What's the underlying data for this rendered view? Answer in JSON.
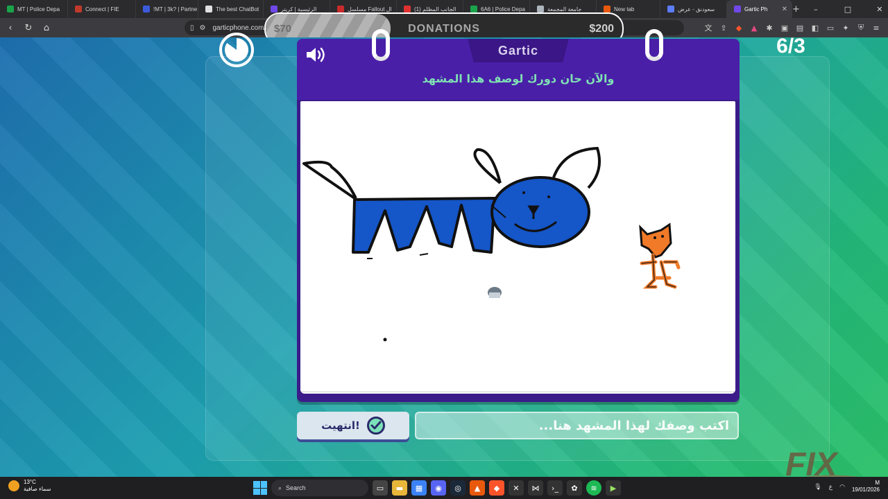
{
  "browser": {
    "tabs": [
      {
        "label": "MT | Police Depa",
        "color": "#1aa34a"
      },
      {
        "label": "Connect | FIE",
        "color": "#c0392b"
      },
      {
        "label": "!MT | 3k? | Partne",
        "color": "#3b5bdb"
      },
      {
        "label": "The best ChatBot",
        "color": "#e0e0e0"
      },
      {
        "label": "الرئيسية | كريتر",
        "color": "#7048e8"
      },
      {
        "label": "مسلسل Fallout ال",
        "color": "#c92a2a"
      },
      {
        "label": "(1) الجانب المظلم",
        "color": "#e03131"
      },
      {
        "label": "6A6 | Police Depa",
        "color": "#1aa34a"
      },
      {
        "label": "جامعة المجمعة",
        "color": "#adb5bd"
      },
      {
        "label": "New tab",
        "color": "#e8590c"
      },
      {
        "label": "سعودنق - عرض",
        "color": "#5c7cfa"
      },
      {
        "label": "Gartic Ph",
        "color": "#7048e8"
      }
    ],
    "url": "garticphone.com/ar/"
  },
  "donations": {
    "current": "$70",
    "label": "DONATIONS",
    "goal": "$200",
    "progress": 0.35
  },
  "game": {
    "logo": "Gartic",
    "round": "6/3",
    "prompt": "والآن حان دورك لوصف هذا المشهد",
    "input_placeholder": "اكتب وصفك لهذا المشهد هنا...",
    "done_label": "انتهيت!",
    "timer_remaining": 0.85,
    "colors": {
      "book": "#3b1b8a",
      "prompt": "#7fe0b4",
      "drawing_blue": "#1556c8",
      "drawing_orange": "#f07a28"
    }
  },
  "taskbar": {
    "weather_temp": "13°C",
    "weather_desc": "سماء صافية",
    "search_label": "Search",
    "date": "19/01/2026",
    "time": "M"
  },
  "watermark": "FIX"
}
